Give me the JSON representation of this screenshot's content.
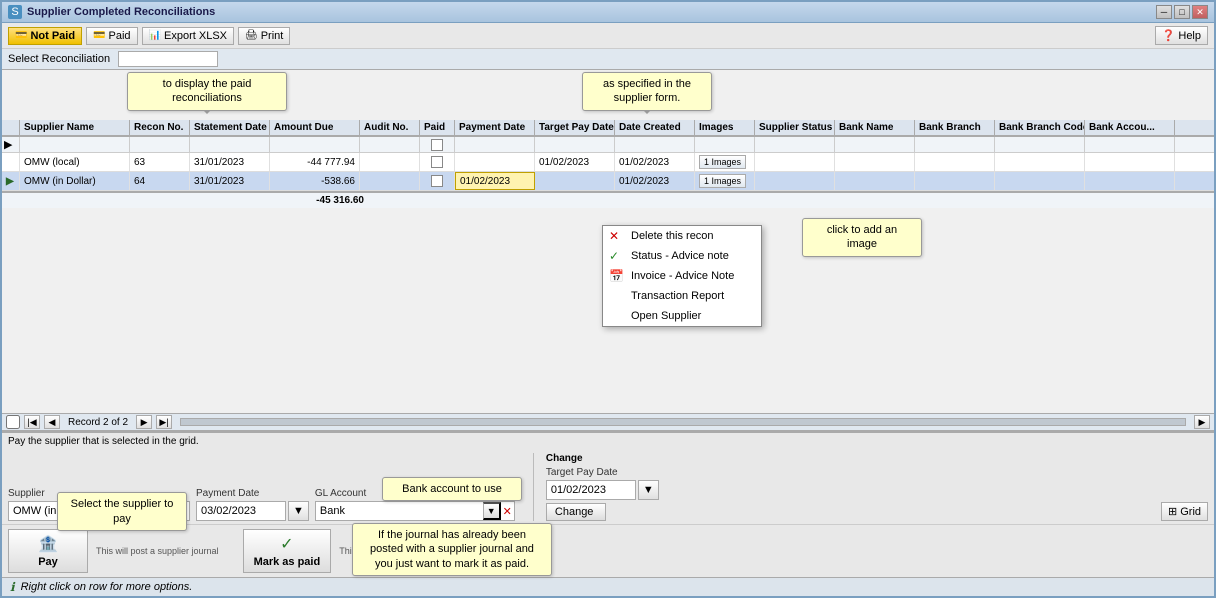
{
  "window": {
    "title": "Supplier Completed Reconciliations",
    "icon": "S"
  },
  "titleButtons": [
    "_",
    "□",
    "✕"
  ],
  "toolbar": {
    "notPaid": "Not Paid",
    "paid": "Paid",
    "exportXlsx": "Export XLSX",
    "print": "Print",
    "help": "Help"
  },
  "tooltips": {
    "paidTooltip": "to display the paid reconciliations",
    "specifiedTooltip": "as specified in the supplier form.",
    "addImageTooltip": "click to add an image",
    "bankAccountTooltip": "Bank account to use",
    "journalTooltip": "If the journal has already been posted with a supplier journal and you just want to mark it as paid.",
    "selectSupplierTooltip": "Select the supplier to pay"
  },
  "reconciliationSelector": {
    "label": "Select Reconciliation"
  },
  "grid": {
    "columns": [
      "",
      "Supplier Name",
      "Recon No.",
      "Statement Date",
      "Amount Due",
      "Audit No.",
      "Paid",
      "Payment Date",
      "Target Pay Date",
      "Date Created",
      "Images",
      "Supplier Status",
      "Bank Name",
      "Bank Branch",
      "Bank Branch Code",
      "Bank Accou..."
    ],
    "filterRow": [
      "▶",
      "",
      "",
      "",
      "",
      "",
      "☐",
      "",
      "",
      "",
      "",
      "",
      "",
      "",
      "",
      ""
    ],
    "rows": [
      {
        "arrow": "",
        "supplierName": "OMW (local)",
        "reconNo": "63",
        "statementDate": "31/01/2023",
        "amountDue": "-44 777.94",
        "auditNo": "",
        "paid": false,
        "paymentDate": "",
        "targetPayDate": "01/02/2023",
        "dateCreated": "01/02/2023",
        "images": "1 Images",
        "supplierStatus": "",
        "bankName": "",
        "bankBranch": "",
        "bankBranchCode": "",
        "bankAccount": ""
      },
      {
        "arrow": "▶",
        "supplierName": "OMW (in Dollar)",
        "reconNo": "64",
        "statementDate": "31/01/2023",
        "amountDue": "-538.66",
        "auditNo": "",
        "paid": false,
        "paymentDate": "01/02/2023",
        "targetPayDate": "",
        "dateCreated": "01/02/2023",
        "images": "1 Images",
        "supplierStatus": "",
        "bankName": "",
        "bankBranch": "",
        "bankBranchCode": "",
        "bankAccount": ""
      }
    ],
    "total": "-45 316.60"
  },
  "navigation": {
    "recordLabel": "Record 2 of 2"
  },
  "contextMenu": {
    "items": [
      {
        "icon": "✕",
        "label": "Delete this recon",
        "iconColor": "#cc0000"
      },
      {
        "icon": "✓",
        "label": "Status - Advice note",
        "iconColor": "#2a8a2a"
      },
      {
        "icon": "📅",
        "label": "Invoice - Advice Note",
        "iconColor": "#888"
      },
      {
        "icon": "",
        "label": "Transaction Report",
        "iconColor": ""
      },
      {
        "icon": "",
        "label": "Open Supplier",
        "iconColor": ""
      }
    ]
  },
  "bottomPanel": {
    "payLabel": "Pay the supplier that is selected in the grid.",
    "supplierLabel": "Supplier",
    "supplierValue": "OMW (in Dollar)",
    "supplierNum": "64",
    "paymentDateLabel": "Payment Date",
    "paymentDateValue": "03/02/2023",
    "glAccountLabel": "GL Account",
    "glValue": "Bank",
    "changeSection": {
      "label": "Change",
      "targetPayDateLabel": "Target Pay Date",
      "targetPayDateValue": "01/02/2023",
      "changeButton": "Change"
    },
    "gridButton": "Grid",
    "payButton": "Pay",
    "paySubLabel": "This will post a supplier journal",
    "markButton": "Mark as paid",
    "markSubLabel": "This will just mark recon as..."
  },
  "statusBar": {
    "text": "Right click on row for more options."
  }
}
